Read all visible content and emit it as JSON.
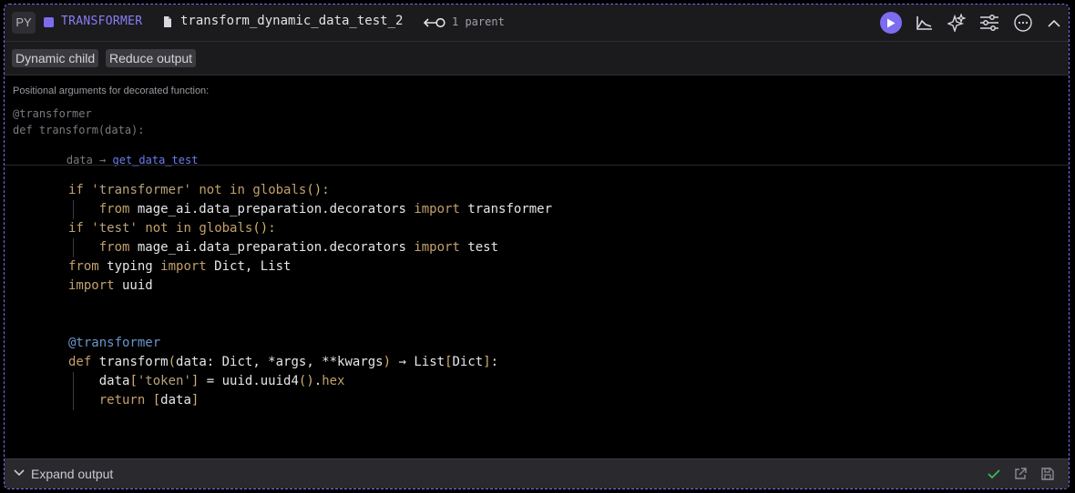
{
  "header": {
    "language": "PY",
    "block_type": "TRANSFORMER",
    "block_name": "transform_dynamic_data_test_2",
    "parent_count": "1 parent"
  },
  "tags": [
    "Dynamic child",
    "Reduce output"
  ],
  "args": {
    "title": "Positional arguments for decorated function:",
    "decorator": "@transformer",
    "signature": "def transform(data):",
    "arg_name": "data",
    "arrow": "→",
    "upstream": "get_data_test"
  },
  "code": {
    "l1": [
      "if",
      " ",
      "'transformer'",
      " ",
      "not",
      " ",
      "in",
      " ",
      "globals",
      "():"
    ],
    "l2": [
      "from",
      " mage_ai.data_preparation.decorators ",
      "import",
      " transformer"
    ],
    "l3": [
      "if",
      " ",
      "'test'",
      " ",
      "not",
      " ",
      "in",
      " ",
      "globals",
      "():"
    ],
    "l4": [
      "from",
      " mage_ai.data_preparation.decorators ",
      "import",
      " test"
    ],
    "l5": [
      "from",
      " typing ",
      "import",
      " Dict, List"
    ],
    "l6": [
      "import",
      " uuid"
    ],
    "l9": "@transformer",
    "l10": [
      "def",
      " transform",
      "(",
      "data: Dict, *args, **kwargs",
      ")",
      " → List",
      "[",
      "Dict",
      "]",
      ":"
    ],
    "l11": [
      "data",
      "[",
      "'token'",
      "]",
      " = uuid.uuid4",
      "()",
      ".",
      "hex"
    ],
    "l12": [
      "return",
      " ",
      "[",
      "data",
      "]"
    ]
  },
  "footer": {
    "expand_label": "Expand output"
  },
  "colors": {
    "accent": "#7d6cf0",
    "success": "#3fb950"
  }
}
